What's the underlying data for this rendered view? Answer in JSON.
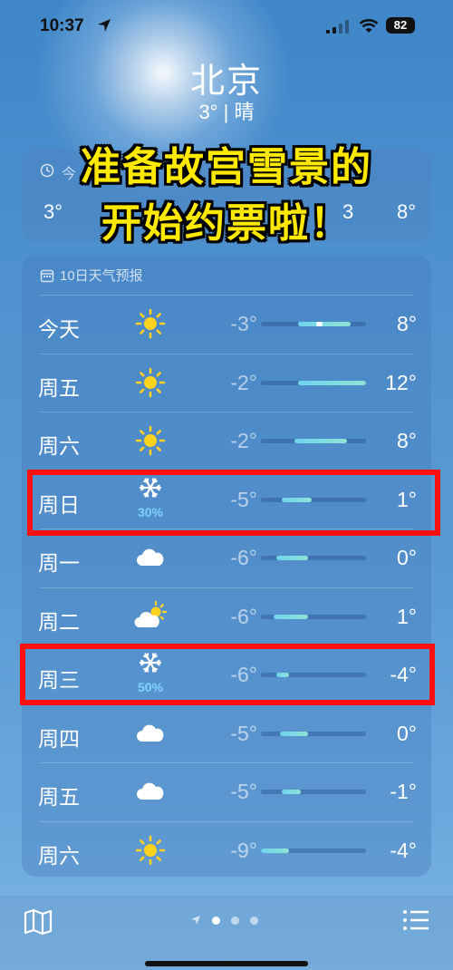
{
  "status": {
    "time": "10:37",
    "battery": "82"
  },
  "header": {
    "city": "北京",
    "condition": "3° | 晴"
  },
  "hourly": {
    "label_fragment": "今",
    "temp_left": "3°",
    "temp_mid": "3",
    "temp_right": "8°"
  },
  "overlay": {
    "line1": "准备故宫雪景的",
    "line2": "开始约票啦！"
  },
  "forecast": {
    "title": "10日天气预报",
    "days": [
      {
        "day": "今天",
        "icon": "sun-icon",
        "precip": "",
        "low": "-3°",
        "high": "8°",
        "bar_start": 0.35,
        "bar_end": 0.85,
        "current": 0.55
      },
      {
        "day": "周五",
        "icon": "sun-icon",
        "precip": "",
        "low": "-2°",
        "high": "12°",
        "bar_start": 0.35,
        "bar_end": 1.0
      },
      {
        "day": "周六",
        "icon": "sun-icon",
        "precip": "",
        "low": "-2°",
        "high": "8°",
        "bar_start": 0.32,
        "bar_end": 0.82
      },
      {
        "day": "周日",
        "icon": "snowflake-icon",
        "precip": "30%",
        "low": "-5°",
        "high": "1°",
        "bar_start": 0.2,
        "bar_end": 0.48
      },
      {
        "day": "周一",
        "icon": "cloud-icon",
        "precip": "",
        "low": "-6°",
        "high": "0°",
        "bar_start": 0.15,
        "bar_end": 0.45
      },
      {
        "day": "周二",
        "icon": "partly-cloudy-icon",
        "precip": "",
        "low": "-6°",
        "high": "1°",
        "bar_start": 0.12,
        "bar_end": 0.45
      },
      {
        "day": "周三",
        "icon": "snowflake-icon",
        "precip": "50%",
        "low": "-6°",
        "high": "-4°",
        "bar_start": 0.15,
        "bar_end": 0.27
      },
      {
        "day": "周四",
        "icon": "cloud-icon",
        "precip": "",
        "low": "-5°",
        "high": "0°",
        "bar_start": 0.18,
        "bar_end": 0.45
      },
      {
        "day": "周五",
        "icon": "cloud-icon",
        "precip": "",
        "low": "-5°",
        "high": "-1°",
        "bar_start": 0.2,
        "bar_end": 0.38
      },
      {
        "day": "周六",
        "icon": "sun-icon",
        "precip": "",
        "low": "-9°",
        "high": "-4°",
        "bar_start": 0.0,
        "bar_end": 0.27
      }
    ]
  },
  "colors": {
    "highlight": "#ff1010",
    "overlay_text": "#ffe900",
    "sun": "#ffd21f",
    "precip": "#7fd4ff"
  }
}
